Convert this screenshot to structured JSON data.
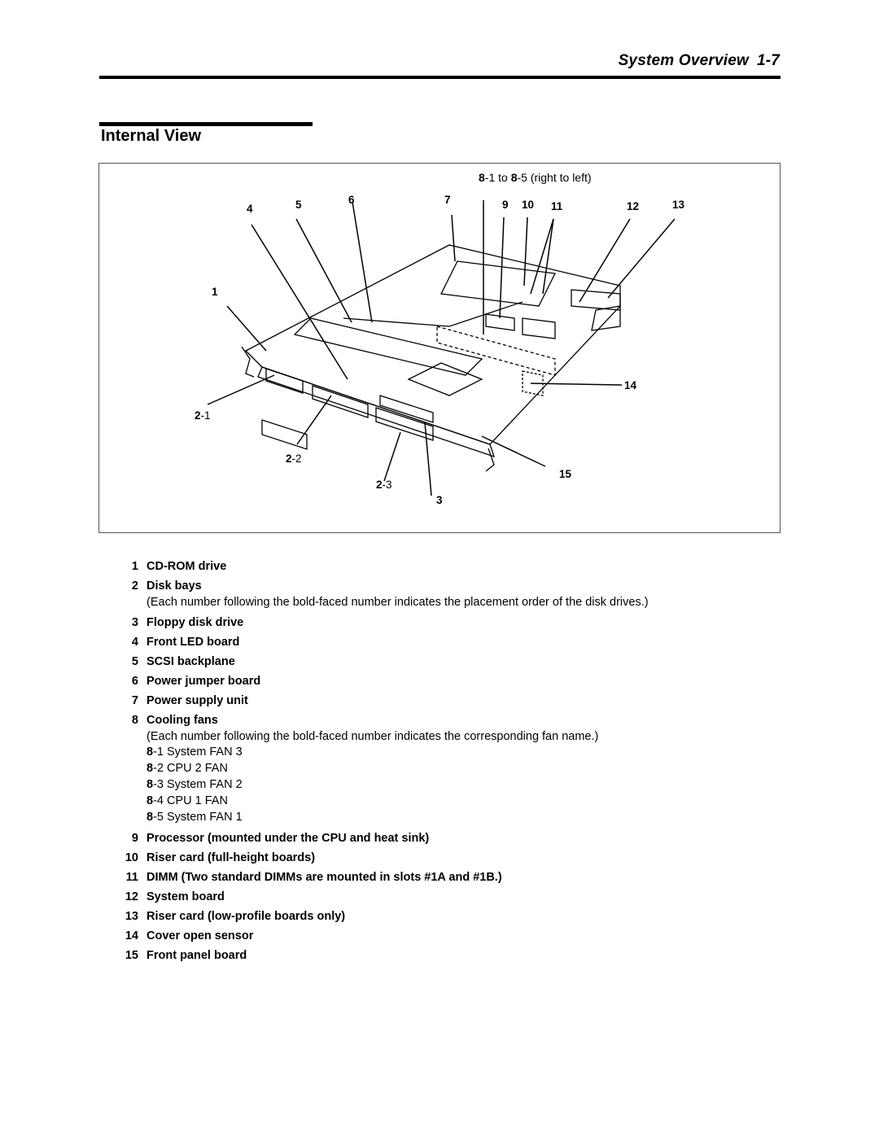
{
  "header": {
    "running_title": "System Overview",
    "page_number": "1-7"
  },
  "section": {
    "title": "Internal View"
  },
  "figure": {
    "fan_caption": {
      "a_bold": "8",
      "a_rest": "-1 to ",
      "b_bold": "8",
      "b_rest": "-5 (right to left)"
    },
    "callouts": [
      {
        "id": "1",
        "bold": "1",
        "rest": ""
      },
      {
        "id": "2-1",
        "bold": "2",
        "rest": "-1"
      },
      {
        "id": "2-2",
        "bold": "2",
        "rest": "-2"
      },
      {
        "id": "2-3",
        "bold": "2",
        "rest": "-3"
      },
      {
        "id": "3",
        "bold": "3",
        "rest": ""
      },
      {
        "id": "4",
        "bold": "4",
        "rest": ""
      },
      {
        "id": "5",
        "bold": "5",
        "rest": ""
      },
      {
        "id": "6",
        "bold": "6",
        "rest": ""
      },
      {
        "id": "7",
        "bold": "7",
        "rest": ""
      },
      {
        "id": "9",
        "bold": "9",
        "rest": ""
      },
      {
        "id": "10",
        "bold": "10",
        "rest": ""
      },
      {
        "id": "11",
        "bold": "11",
        "rest": ""
      },
      {
        "id": "12",
        "bold": "12",
        "rest": ""
      },
      {
        "id": "13",
        "bold": "13",
        "rest": ""
      },
      {
        "id": "14",
        "bold": "14",
        "rest": ""
      },
      {
        "id": "15",
        "bold": "15",
        "rest": ""
      }
    ]
  },
  "legend": {
    "items": [
      {
        "num": "1",
        "label": "CD-ROM drive"
      },
      {
        "num": "2",
        "label": "Disk bays",
        "note": "(Each number following the bold-faced number indicates the placement order of the disk drives.)"
      },
      {
        "num": "3",
        "label": "Floppy disk drive"
      },
      {
        "num": "4",
        "label": "Front LED board"
      },
      {
        "num": "5",
        "label": "SCSI backplane"
      },
      {
        "num": "6",
        "label": "Power jumper board"
      },
      {
        "num": "7",
        "label": "Power supply unit"
      },
      {
        "num": "8",
        "label": "Cooling fans",
        "note": "(Each number following the bold-faced number indicates the corresponding fan name.)",
        "subitems": [
          {
            "bold": "8",
            "rest": "-1 System FAN 3"
          },
          {
            "bold": "8",
            "rest": "-2 CPU 2 FAN"
          },
          {
            "bold": "8",
            "rest": "-3 System FAN 2"
          },
          {
            "bold": "8",
            "rest": "-4 CPU 1 FAN"
          },
          {
            "bold": "8",
            "rest": "-5 System FAN 1"
          }
        ]
      },
      {
        "num": "9",
        "label": "Processor (mounted under the CPU and heat sink)"
      },
      {
        "num": "10",
        "label": "Riser card (full-height boards)"
      },
      {
        "num": "11",
        "label": "DIMM (Two standard DIMMs are mounted in slots #1A and #1B.)"
      },
      {
        "num": "12",
        "label": "System board"
      },
      {
        "num": "13",
        "label": "Riser card (low-profile boards only)"
      },
      {
        "num": "14",
        "label": "Cover open sensor"
      },
      {
        "num": "15",
        "label": "Front panel board"
      }
    ]
  }
}
